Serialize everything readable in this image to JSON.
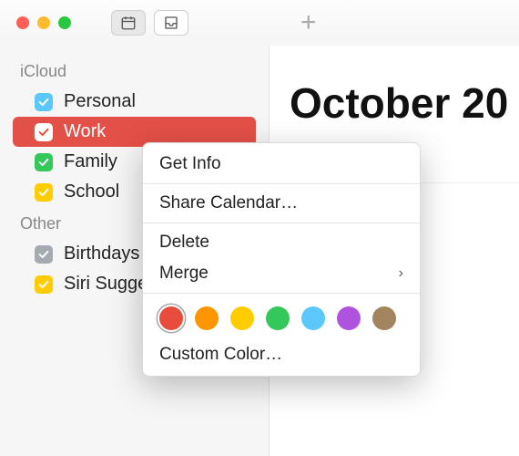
{
  "sections": {
    "icloud": {
      "label": "iCloud",
      "items": [
        {
          "label": "Personal",
          "color": "#5ac8fa"
        },
        {
          "label": "Work",
          "color": "#e74c3c",
          "selected": true
        },
        {
          "label": "Family",
          "color": "#34c759"
        },
        {
          "label": "School",
          "color": "#ffcc00"
        }
      ]
    },
    "other": {
      "label": "Other",
      "items": [
        {
          "label": "Birthdays",
          "color": "#a5a9b0"
        },
        {
          "label": "Siri Suggestions",
          "color": "#ffcc00"
        }
      ]
    }
  },
  "main": {
    "month_title": "October 20",
    "plus": "+"
  },
  "context_menu": {
    "get_info": "Get Info",
    "share": "Share Calendar…",
    "delete": "Delete",
    "merge": "Merge",
    "colors": [
      "#e74c3c",
      "#ff9500",
      "#ffcc00",
      "#34c759",
      "#5ac8fa",
      "#af52de",
      "#a2845e"
    ],
    "selected_color": 0,
    "custom_color": "Custom Color…"
  }
}
